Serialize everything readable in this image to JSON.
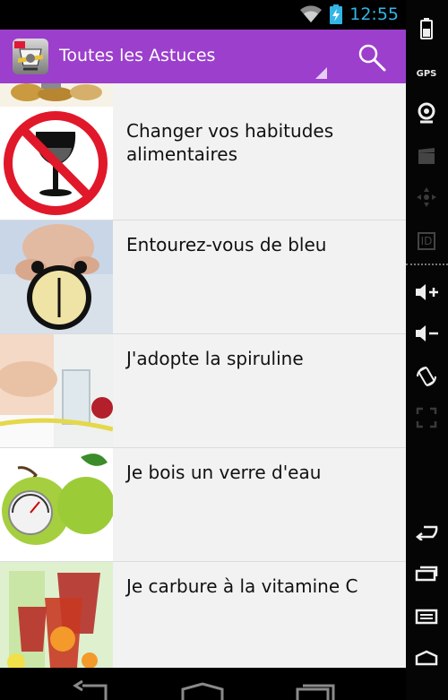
{
  "status_bar": {
    "time": "12:55",
    "accent": "#33b5e5"
  },
  "action_bar": {
    "title": "Toutes les Astuces",
    "color": "#9c3fcc",
    "search_icon": "search-icon"
  },
  "list": {
    "items": [
      {
        "title": "Changer vos habitudes alimentaires",
        "image": "no-alcohol-sign"
      },
      {
        "title": "Entourez-vous de bleu",
        "image": "baby-with-alarm-clock"
      },
      {
        "title": "J'adopte la spiruline",
        "image": "belly-with-measuring-tape"
      },
      {
        "title": "Je bois un verre d'eau",
        "image": "apple-with-scale"
      },
      {
        "title": "Je carbure à la vitamine C",
        "image": "fruit-juice-glasses"
      }
    ]
  },
  "side_panel": {
    "icons": [
      "battery-icon",
      "gps-icon",
      "camera-icon",
      "clapperboard-icon",
      "dpad-icon",
      "id-icon",
      "volume-up-icon",
      "volume-down-icon",
      "rotate-icon",
      "resize-icon",
      "back-icon",
      "recent-apps-icon",
      "menu-icon",
      "home-icon"
    ],
    "gps_label": "GPS",
    "id_label": "ID"
  }
}
